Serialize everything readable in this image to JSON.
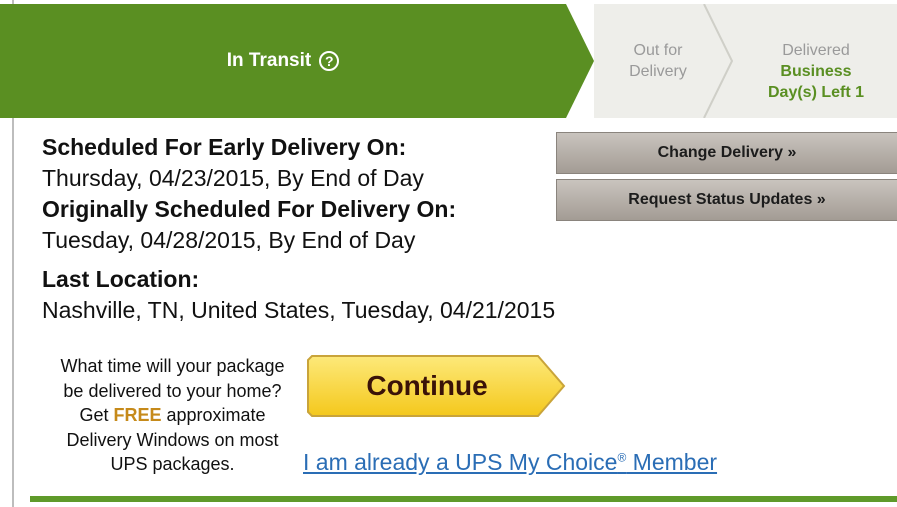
{
  "tracker": {
    "active_step": "In Transit",
    "help_glyph": "?",
    "out_for_line1": "Out for",
    "out_for_line2": "Delivery",
    "delivered": "Delivered",
    "days_left_line1": "Business",
    "days_left_line2": "Day(s) Left 1",
    "active_color": "#5a8f22"
  },
  "delivery": {
    "early_heading": "Scheduled For Early Delivery On:",
    "early_value": "Thursday, 04/23/2015, By End of Day",
    "orig_heading": "Originally Scheduled For Delivery On:",
    "orig_value": "Tuesday, 04/28/2015, By End of Day",
    "location_heading": "Last Location:",
    "location_value": "Nashville, TN, United States, Tuesday, 04/21/2015"
  },
  "actions": {
    "change_delivery": "Change Delivery »",
    "request_updates": "Request Status Updates »"
  },
  "promo": {
    "line1": "What time will your package",
    "line2": "be delivered to your home?",
    "line3_pre": "Get ",
    "line3_free": "FREE",
    "line3_post": " approximate",
    "line4": "Delivery Windows on most",
    "line5": "UPS packages.",
    "continue_label": "Continue",
    "member_link": "I am already a UPS My Choice",
    "member_reg": "®",
    "member_suffix": " Member"
  }
}
